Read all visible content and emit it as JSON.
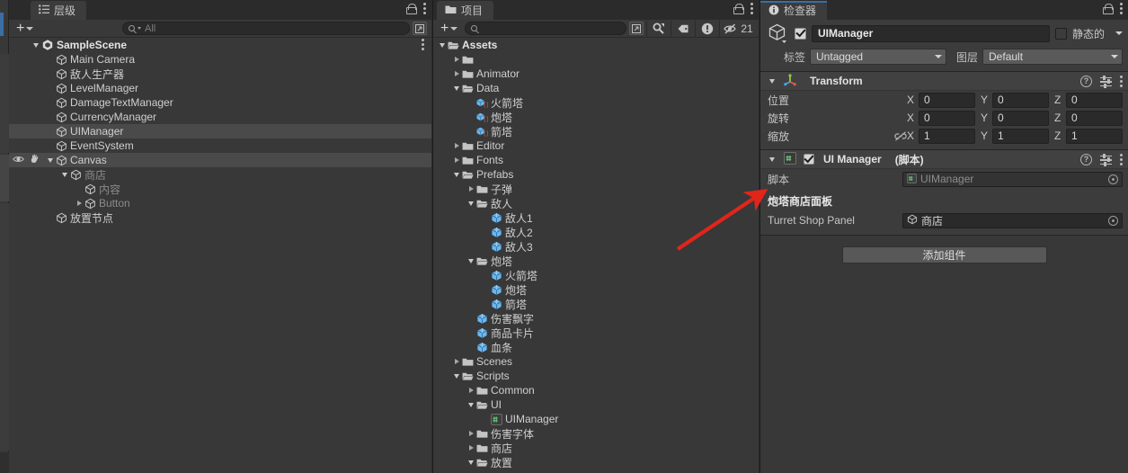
{
  "hierarchy": {
    "tab_label": "层级",
    "tab_icon": "hierarchy-icon",
    "add_label": "+",
    "search_placeholder": "All",
    "items": [
      {
        "label": "SampleScene",
        "depth": 0,
        "expander": "down",
        "icon": "unity-scene-icon",
        "bold": true,
        "selected": false,
        "dim": false,
        "kebab": true
      },
      {
        "label": "Main Camera",
        "depth": 1,
        "expander": "none",
        "icon": "gameobject-icon",
        "bold": false,
        "selected": false,
        "dim": false
      },
      {
        "label": "敌人生产器",
        "depth": 1,
        "expander": "none",
        "icon": "gameobject-icon",
        "bold": false,
        "selected": false,
        "dim": false
      },
      {
        "label": "LevelManager",
        "depth": 1,
        "expander": "none",
        "icon": "gameobject-icon",
        "bold": false,
        "selected": false,
        "dim": false
      },
      {
        "label": "DamageTextManager",
        "depth": 1,
        "expander": "none",
        "icon": "gameobject-icon",
        "bold": false,
        "selected": false,
        "dim": false
      },
      {
        "label": "CurrencyManager",
        "depth": 1,
        "expander": "none",
        "icon": "gameobject-icon",
        "bold": false,
        "selected": false,
        "dim": false
      },
      {
        "label": "UIManager",
        "depth": 1,
        "expander": "none",
        "icon": "gameobject-icon",
        "bold": false,
        "selected": true,
        "dim": false
      },
      {
        "label": "EventSystem",
        "depth": 1,
        "expander": "none",
        "icon": "gameobject-icon",
        "bold": false,
        "selected": false,
        "dim": false
      },
      {
        "label": "Canvas",
        "depth": 1,
        "expander": "down",
        "icon": "gameobject-icon",
        "bold": false,
        "selected": true,
        "dim": false,
        "visibility_icons": true
      },
      {
        "label": "商店",
        "depth": 2,
        "expander": "down",
        "icon": "gameobject-icon",
        "bold": false,
        "selected": false,
        "dim": true
      },
      {
        "label": "内容",
        "depth": 3,
        "expander": "none",
        "icon": "gameobject-icon",
        "bold": false,
        "selected": false,
        "dim": true
      },
      {
        "label": "Button",
        "depth": 3,
        "expander": "right",
        "icon": "gameobject-icon",
        "bold": false,
        "selected": false,
        "dim": true
      },
      {
        "label": "放置节点",
        "depth": 1,
        "expander": "none",
        "icon": "gameobject-icon",
        "bold": false,
        "selected": false,
        "dim": false
      }
    ]
  },
  "project": {
    "tab_label": "项目",
    "tab_icon": "folder-icon",
    "add_label": "+",
    "search_placeholder": "",
    "toolbar_icons": [
      "save-search-icon",
      "favorite-search-icon",
      "label-tag-icon",
      "warning-icon",
      "hidden-eye-icon"
    ],
    "hidden_count": "21",
    "items": [
      {
        "label": "Assets",
        "depth": 0,
        "expander": "down",
        "icon": "folder-open-icon",
        "bold": true
      },
      {
        "label": "",
        "depth": 1,
        "expander": "right",
        "icon": "folder-icon",
        "bold": false
      },
      {
        "label": "Animator",
        "depth": 1,
        "expander": "right",
        "icon": "folder-icon",
        "bold": false
      },
      {
        "label": "Data",
        "depth": 1,
        "expander": "down",
        "icon": "folder-open-icon",
        "bold": false
      },
      {
        "label": "火箭塔",
        "depth": 2,
        "expander": "none",
        "icon": "scriptable-object-icon",
        "bold": false
      },
      {
        "label": "炮塔",
        "depth": 2,
        "expander": "none",
        "icon": "scriptable-object-icon",
        "bold": false
      },
      {
        "label": "箭塔",
        "depth": 2,
        "expander": "none",
        "icon": "scriptable-object-icon",
        "bold": false
      },
      {
        "label": "Editor",
        "depth": 1,
        "expander": "right",
        "icon": "folder-icon",
        "bold": false
      },
      {
        "label": "Fonts",
        "depth": 1,
        "expander": "right",
        "icon": "folder-icon",
        "bold": false
      },
      {
        "label": "Prefabs",
        "depth": 1,
        "expander": "down",
        "icon": "folder-open-icon",
        "bold": false
      },
      {
        "label": "子弹",
        "depth": 2,
        "expander": "right",
        "icon": "folder-icon",
        "bold": false
      },
      {
        "label": "敌人",
        "depth": 2,
        "expander": "down",
        "icon": "folder-open-icon",
        "bold": false
      },
      {
        "label": "敌人1",
        "depth": 3,
        "expander": "none",
        "icon": "prefab-icon",
        "bold": false
      },
      {
        "label": "敌人2",
        "depth": 3,
        "expander": "none",
        "icon": "prefab-icon",
        "bold": false
      },
      {
        "label": "敌人3",
        "depth": 3,
        "expander": "none",
        "icon": "prefab-icon",
        "bold": false
      },
      {
        "label": "炮塔",
        "depth": 2,
        "expander": "down",
        "icon": "folder-open-icon",
        "bold": false
      },
      {
        "label": "火箭塔",
        "depth": 3,
        "expander": "none",
        "icon": "prefab-icon",
        "bold": false
      },
      {
        "label": "炮塔",
        "depth": 3,
        "expander": "none",
        "icon": "prefab-icon",
        "bold": false
      },
      {
        "label": "箭塔",
        "depth": 3,
        "expander": "none",
        "icon": "prefab-icon",
        "bold": false
      },
      {
        "label": "伤害飘字",
        "depth": 2,
        "expander": "none",
        "icon": "prefab-icon",
        "bold": false
      },
      {
        "label": "商品卡片",
        "depth": 2,
        "expander": "none",
        "icon": "prefab-icon",
        "bold": false
      },
      {
        "label": "血条",
        "depth": 2,
        "expander": "none",
        "icon": "prefab-icon",
        "bold": false
      },
      {
        "label": "Scenes",
        "depth": 1,
        "expander": "right",
        "icon": "folder-icon",
        "bold": false
      },
      {
        "label": "Scripts",
        "depth": 1,
        "expander": "down",
        "icon": "folder-open-icon",
        "bold": false
      },
      {
        "label": "Common",
        "depth": 2,
        "expander": "right",
        "icon": "folder-icon",
        "bold": false
      },
      {
        "label": "UI",
        "depth": 2,
        "expander": "down",
        "icon": "folder-open-icon",
        "bold": false
      },
      {
        "label": "UIManager",
        "depth": 3,
        "expander": "none",
        "icon": "csharp-script-icon",
        "bold": false
      },
      {
        "label": "伤害字体",
        "depth": 2,
        "expander": "right",
        "icon": "folder-icon",
        "bold": false
      },
      {
        "label": "商店",
        "depth": 2,
        "expander": "right",
        "icon": "folder-icon",
        "bold": false
      },
      {
        "label": "放置",
        "depth": 2,
        "expander": "down",
        "icon": "folder-open-icon",
        "bold": false
      }
    ]
  },
  "inspector": {
    "tab_label": "检查器",
    "tab_icon": "info-icon",
    "object_name": "UIManager",
    "object_enabled": true,
    "static_label": "静态的",
    "static_checked": false,
    "tag_label": "标签",
    "tag_value": "Untagged",
    "layer_label": "图层",
    "layer_value": "Default",
    "transform": {
      "title": "Transform",
      "icon": "transform-axis-icon",
      "rows": [
        {
          "label": "位置",
          "x": "0",
          "y": "0",
          "z": "0",
          "link": false
        },
        {
          "label": "旋转",
          "x": "0",
          "y": "0",
          "z": "0",
          "link": false
        },
        {
          "label": "缩放",
          "x": "1",
          "y": "1",
          "z": "1",
          "link": true
        }
      ],
      "axis_labels": [
        "X",
        "Y",
        "Z"
      ]
    },
    "ui_manager": {
      "title": "UI Manager",
      "title_suffix": "(脚本)",
      "icon": "csharp-script-icon",
      "enabled": true,
      "script_label": "脚本",
      "script_value": "UIManager",
      "section_header": "炮塔商店面板",
      "field_label": "Turret Shop Panel",
      "field_value": "商店"
    },
    "add_component_label": "添加组件"
  },
  "annotation": {
    "type": "red-arrow",
    "color": "#e1251b"
  }
}
